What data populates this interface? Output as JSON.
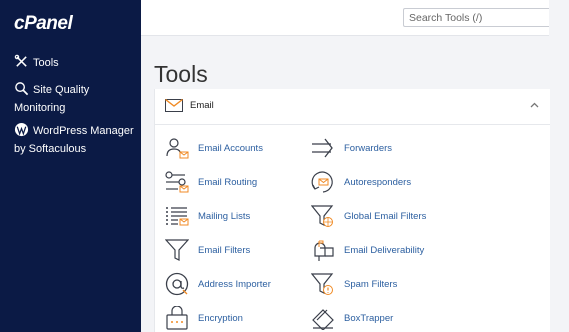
{
  "brand": {
    "logo": "cPanel"
  },
  "sidebar": {
    "items": [
      {
        "label": "Tools",
        "icon": "tools-icon"
      },
      {
        "label": "Site Quality Monitoring",
        "icon": "magnifier-icon"
      },
      {
        "label": "WordPress Manager by Softaculous",
        "icon": "wordpress-icon"
      }
    ]
  },
  "search": {
    "placeholder": "Search Tools (/)",
    "value": ""
  },
  "page": {
    "title": "Tools"
  },
  "section": {
    "label": "Email",
    "icon": "envelope-icon",
    "state": "expanded",
    "tools": [
      {
        "label": "Email Accounts",
        "icon": "user-envelope-icon"
      },
      {
        "label": "Forwarders",
        "icon": "forward-arrow-icon"
      },
      {
        "label": "Email Routing",
        "icon": "routing-icon"
      },
      {
        "label": "Autoresponders",
        "icon": "autoresponder-icon"
      },
      {
        "label": "Mailing Lists",
        "icon": "mailing-list-icon"
      },
      {
        "label": "Global Email Filters",
        "icon": "global-filter-icon"
      },
      {
        "label": "Email Filters",
        "icon": "filter-icon"
      },
      {
        "label": "Email Deliverability",
        "icon": "mailbox-icon"
      },
      {
        "label": "Address Importer",
        "icon": "at-sign-icon"
      },
      {
        "label": "Spam Filters",
        "icon": "spam-filter-icon"
      },
      {
        "label": "Encryption",
        "icon": "lock-icon"
      },
      {
        "label": "BoxTrapper",
        "icon": "box-trap-icon"
      }
    ]
  },
  "colors": {
    "sidebar_bg": "#0b1a45",
    "accent_orange": "#f08a24",
    "link_blue": "#2c5fa0",
    "icon_dark": "#3a3f4a"
  }
}
